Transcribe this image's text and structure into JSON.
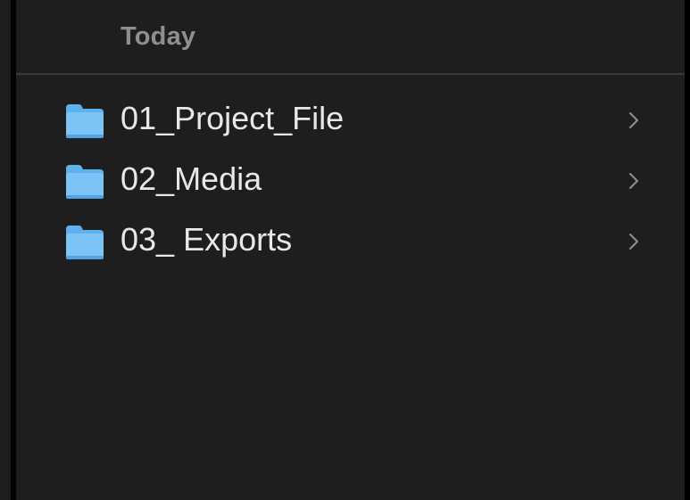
{
  "section": {
    "title": "Today"
  },
  "files": [
    {
      "name": "01_Project_File",
      "icon": "folder-icon",
      "accessory": "chevron-right-icon"
    },
    {
      "name": "02_Media",
      "icon": "folder-icon",
      "accessory": "chevron-right-icon"
    },
    {
      "name": "03_ Exports",
      "icon": "folder-icon",
      "accessory": "chevron-right-icon"
    }
  ],
  "colors": {
    "background": "#1e1e1e",
    "divider": "#3a3a3c",
    "header_text": "#8e8e93",
    "item_text": "#e8e8e8",
    "folder_light": "#7cc4f5",
    "folder_dark": "#3d97e0",
    "chevron": "#8e8e93"
  }
}
